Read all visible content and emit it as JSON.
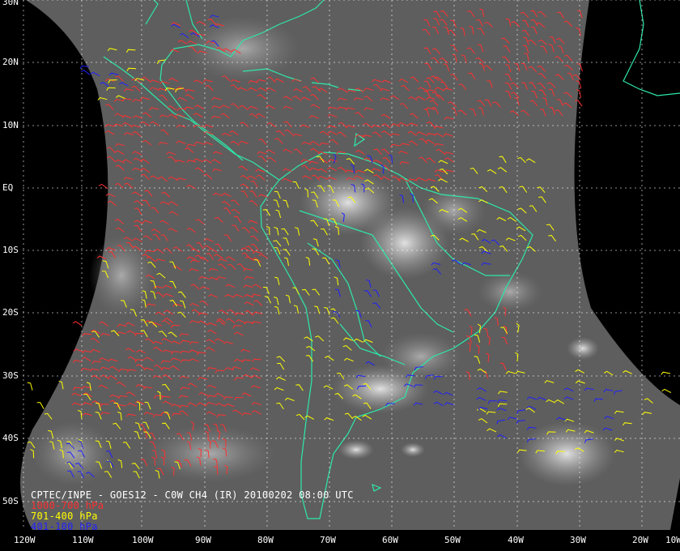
{
  "image": {
    "product": "CPTEC/INPE - GOES12 - C0W CH4 (IR) 20100202 08:00 UTC",
    "background_color": "#000000",
    "gridline_color": "#ffffff",
    "coastline_color": "#2ee8a8"
  },
  "graticule": {
    "latitude_labels": [
      "30N",
      "20N",
      "10N",
      "EQ",
      "10S",
      "20S",
      "30S",
      "40S",
      "50S"
    ],
    "longitude_labels": [
      "120W",
      "110W",
      "100W",
      "90W",
      "80W",
      "70W",
      "60W",
      "50W",
      "40W",
      "30W",
      "20W",
      "10W"
    ]
  },
  "legend": [
    {
      "label": "1000-700 hPa",
      "color": "#ff3030"
    },
    {
      "label": "701-400 hPa",
      "color": "#ffff00"
    },
    {
      "label": "401-100 hPa",
      "color": "#2020ff"
    }
  ]
}
